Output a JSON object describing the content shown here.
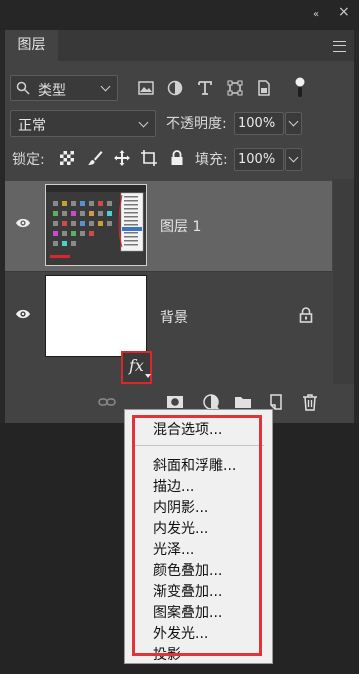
{
  "window": {
    "collapse_icon": "double-chevron-left-icon",
    "close_icon": "close-icon",
    "collapse_glyph": "«",
    "close_glyph": "×"
  },
  "tabs": {
    "active_label": "图层",
    "menu_icon": "panel-menu-icon"
  },
  "filter": {
    "kind_label": "类型",
    "icons": [
      "image-filter-icon",
      "adjustment-filter-icon",
      "type-filter-icon",
      "shape-filter-icon",
      "smart-object-filter-icon",
      "filter-toggle-icon"
    ]
  },
  "blend": {
    "mode": "正常",
    "opacity_label": "不透明度:",
    "opacity_value": "100%"
  },
  "lock": {
    "label": "锁定:",
    "icons": [
      "lock-transparent-pixels-icon",
      "lock-image-pixels-icon",
      "lock-position-icon",
      "lock-artboard-icon",
      "lock-all-icon"
    ],
    "fill_label": "填充:",
    "fill_value": "100%"
  },
  "layers": [
    {
      "name": "图层 1",
      "visible": true,
      "selected": true,
      "locked": false
    },
    {
      "name": "背景",
      "visible": true,
      "selected": false,
      "locked": true
    }
  ],
  "footer": {
    "fx_label": "fx",
    "icons": [
      "link-layers-icon",
      "add-layer-style-icon",
      "add-mask-icon",
      "adjustment-layer-icon",
      "new-group-icon",
      "new-layer-icon",
      "delete-layer-icon"
    ]
  },
  "style_menu": {
    "first": "混合选项...",
    "items": [
      "斜面和浮雕...",
      "描边...",
      "内阴影...",
      "内发光...",
      "光泽...",
      "颜色叠加...",
      "渐变叠加...",
      "图案叠加...",
      "外发光...",
      "投影"
    ]
  },
  "colors": {
    "panel": "#434343",
    "selected_row": "#646464",
    "highlight": "#e0343a",
    "menu_bg": "#f0f0f0"
  }
}
